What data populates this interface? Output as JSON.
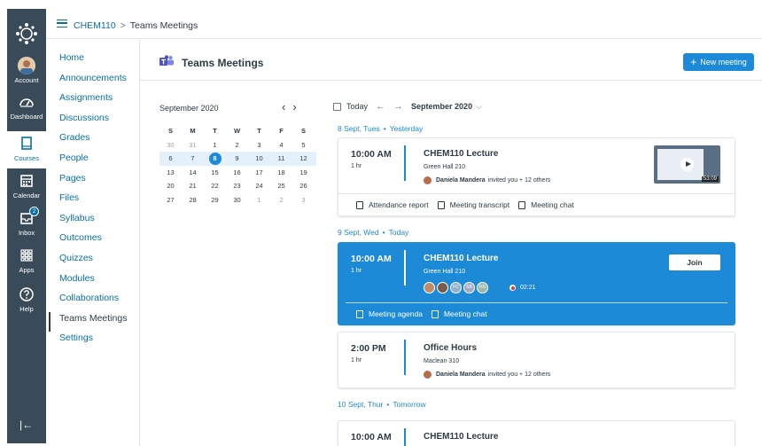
{
  "global_nav": {
    "items": [
      {
        "label": "Account",
        "icon": "avatar"
      },
      {
        "label": "Dashboard",
        "icon": "dashboard-icon"
      },
      {
        "label": "Courses",
        "icon": "book-icon"
      },
      {
        "label": "Calendar",
        "icon": "calendar-icon"
      },
      {
        "label": "Inbox",
        "icon": "inbox-icon",
        "badge": "2"
      },
      {
        "label": "Apps",
        "icon": "apps-grid-icon"
      },
      {
        "label": "Help",
        "icon": "help-icon"
      }
    ],
    "collapse": "|←"
  },
  "breadcrumb": {
    "course": "CHEM110",
    "separator": ">",
    "page": "Teams Meetings"
  },
  "course_nav": {
    "items": [
      "Home",
      "Announcements",
      "Assignments",
      "Discussions",
      "Grades",
      "People",
      "Pages",
      "Files",
      "Syllabus",
      "Outcomes",
      "Quizzes",
      "Modules",
      "Collaborations",
      "Teams Meetings",
      "Settings"
    ],
    "selected": "Teams Meetings"
  },
  "header": {
    "title": "Teams Meetings",
    "new_meeting_label": "New meeting",
    "new_meeting_icon": "+"
  },
  "mini_calendar": {
    "month_label": "September 2020",
    "prev": "‹",
    "next": "›",
    "days_of_week": [
      "S",
      "M",
      "T",
      "W",
      "T",
      "F",
      "S"
    ],
    "weeks": [
      [
        "30",
        "31",
        "1",
        "2",
        "3",
        "4",
        "5"
      ],
      [
        "6",
        "7",
        "8",
        "9",
        "10",
        "11",
        "12"
      ],
      [
        "13",
        "14",
        "15",
        "16",
        "17",
        "18",
        "19"
      ],
      [
        "20",
        "21",
        "22",
        "23",
        "24",
        "25",
        "26"
      ],
      [
        "27",
        "28",
        "29",
        "30",
        "1",
        "2",
        "3"
      ]
    ],
    "selected_day": "8"
  },
  "agenda_toolbar": {
    "today_label": "Today",
    "prev_arrow": "←",
    "next_arrow": "→",
    "month_label": "September 2020",
    "chevron": "⌵"
  },
  "days": [
    {
      "date": "8 Sept, Tues",
      "relative": "Yesterday"
    },
    {
      "date": "9 Sept, Wed",
      "relative": "Today"
    },
    {
      "date": "10 Sept, Thur",
      "relative": "Tomorrow"
    }
  ],
  "meetings": [
    {
      "time": "10:00 AM",
      "duration": "1 hr",
      "title": "CHEM110 Lecture",
      "location": "Green Hall 210",
      "organizer": "Daniela Mandera",
      "invite_text": "invited you + 12 others",
      "recording_duration": "53:09",
      "actions": [
        "Attendance report",
        "Meeting transcript",
        "Meeting chat"
      ]
    },
    {
      "time": "10:00 AM",
      "duration": "1 hr",
      "title": "CHEM110 Lecture",
      "location": "Green Hall 210",
      "join_label": "Join",
      "attendee_initials": [
        "FC",
        "SB",
        "HS"
      ],
      "live_timer": "02:21",
      "actions": [
        "Meeting agenda",
        "Meeting chat"
      ]
    },
    {
      "time": "2:00 PM",
      "duration": "1 hr",
      "title": "Office Hours",
      "location": "Maclean 310",
      "organizer": "Daniela Mandera",
      "invite_text": "invited you + 12 others"
    },
    {
      "time": "10:00 AM",
      "title": "CHEM110 Lecture"
    }
  ],
  "colors": {
    "brand_blue": "#1d8ad8",
    "link": "#0770a3",
    "nav_bg": "#394b58",
    "teams_purple": "#5059c9"
  }
}
